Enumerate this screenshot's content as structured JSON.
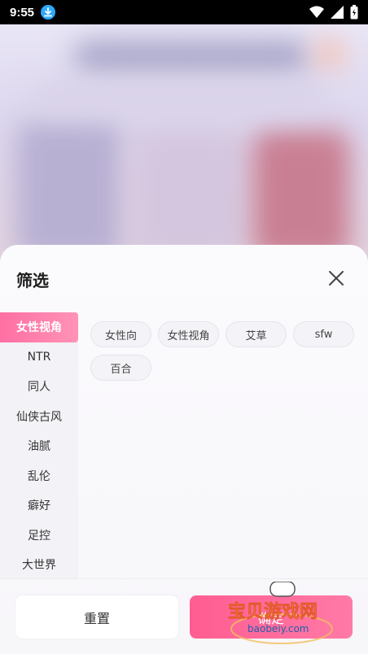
{
  "status_bar": {
    "time": "9:55"
  },
  "sheet": {
    "title": "筛选",
    "categories": [
      {
        "label": "女性视角",
        "active": true
      },
      {
        "label": "NTR",
        "active": false
      },
      {
        "label": "同人",
        "active": false
      },
      {
        "label": "仙侠古风",
        "active": false
      },
      {
        "label": "油腻",
        "active": false
      },
      {
        "label": "乱伦",
        "active": false
      },
      {
        "label": "癖好",
        "active": false
      },
      {
        "label": "足控",
        "active": false
      },
      {
        "label": "大世界",
        "active": false
      }
    ],
    "tags": [
      "女性向",
      "女性视角",
      "艾草",
      "sfw",
      "百合"
    ],
    "reset_label": "重置",
    "confirm_label": "确定"
  },
  "watermark": {
    "title": "宝贝游戏网",
    "url": "baobeiy.com"
  },
  "colors": {
    "accent": "#ff6fa3",
    "status_download": "#2ea8ff"
  }
}
